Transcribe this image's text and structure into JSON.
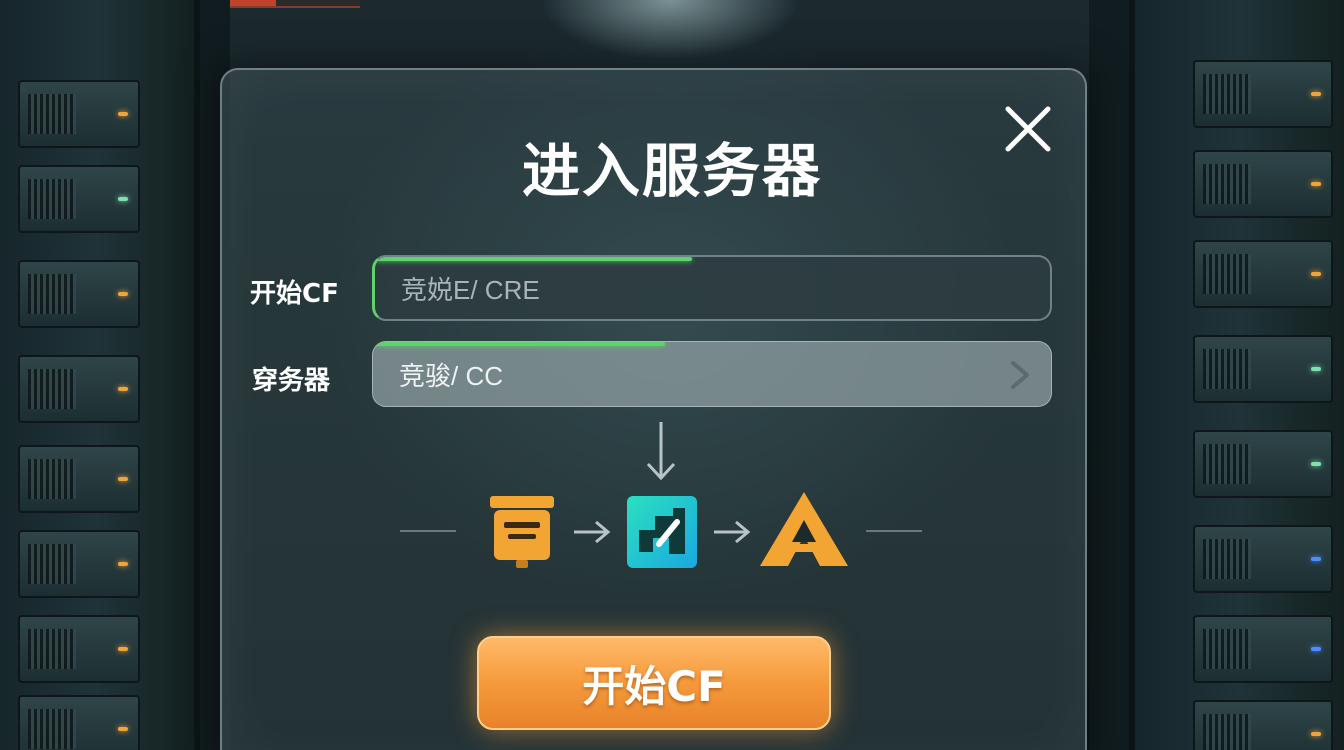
{
  "dialog": {
    "title": "进入服务器",
    "close_icon": "close-icon"
  },
  "form": {
    "row1_label": "开始CF",
    "row1_value": "竞娧E/ CRE",
    "row1_progress": 0.47,
    "row2_label": "穿务器",
    "row2_value": "竞骏/ CC",
    "row2_progress": 0.43,
    "row2_icon": "chevron-right-icon"
  },
  "flow": {
    "down_arrow_icon": "arrow-down-icon",
    "icons": [
      "box-icon",
      "arrow-right-icon",
      "teal-logo-icon",
      "arrow-right-icon",
      "a-logo-icon"
    ]
  },
  "action": {
    "start_label": "开始CF"
  },
  "colors": {
    "accent_green": "#5fd36b",
    "button_orange": "#f59a3c",
    "box_icon_orange": "#f2a533",
    "teal_icon": "#29c6d6"
  }
}
